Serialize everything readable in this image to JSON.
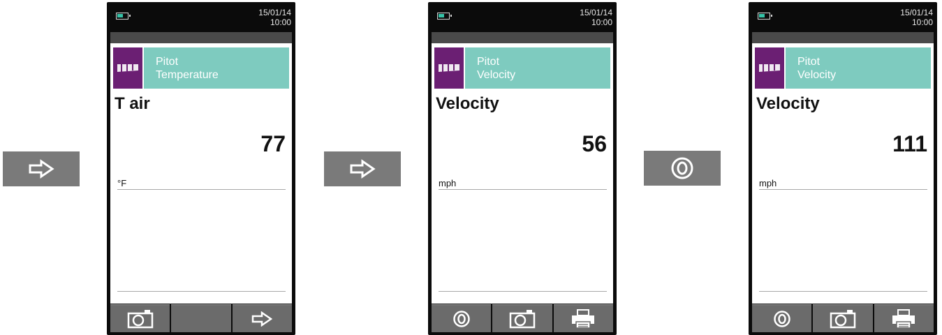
{
  "flow": {
    "step1_icon": "right-arrow-icon",
    "step2_icon": "right-arrow-icon",
    "step3_icon": "circle-o-icon"
  },
  "devices": [
    {
      "date": "15/01/14",
      "time": "10:00",
      "header_line1": "Pitot",
      "header_line2": "Temperature",
      "parameter": "T air",
      "value": "77",
      "unit": "°F",
      "softkeys": [
        "camera-icon",
        "",
        "right-arrow-icon"
      ]
    },
    {
      "date": "15/01/14",
      "time": "10:00",
      "header_line1": "Pitot",
      "header_line2": "Velocity",
      "parameter": "Velocity",
      "value": "56",
      "unit": "mph",
      "softkeys": [
        "circle-o-icon",
        "camera-icon",
        "printer-icon"
      ]
    },
    {
      "date": "15/01/14",
      "time": "10:00",
      "header_line1": "Pitot",
      "header_line2": "Velocity",
      "parameter": "Velocity",
      "value": "111",
      "unit": "mph",
      "softkeys": [
        "circle-o-icon",
        "camera-icon",
        "printer-icon"
      ]
    }
  ],
  "colors": {
    "header_teal": "#7ecbbf",
    "header_purple": "#6b1f73",
    "step_gray": "#7a7a7a"
  }
}
